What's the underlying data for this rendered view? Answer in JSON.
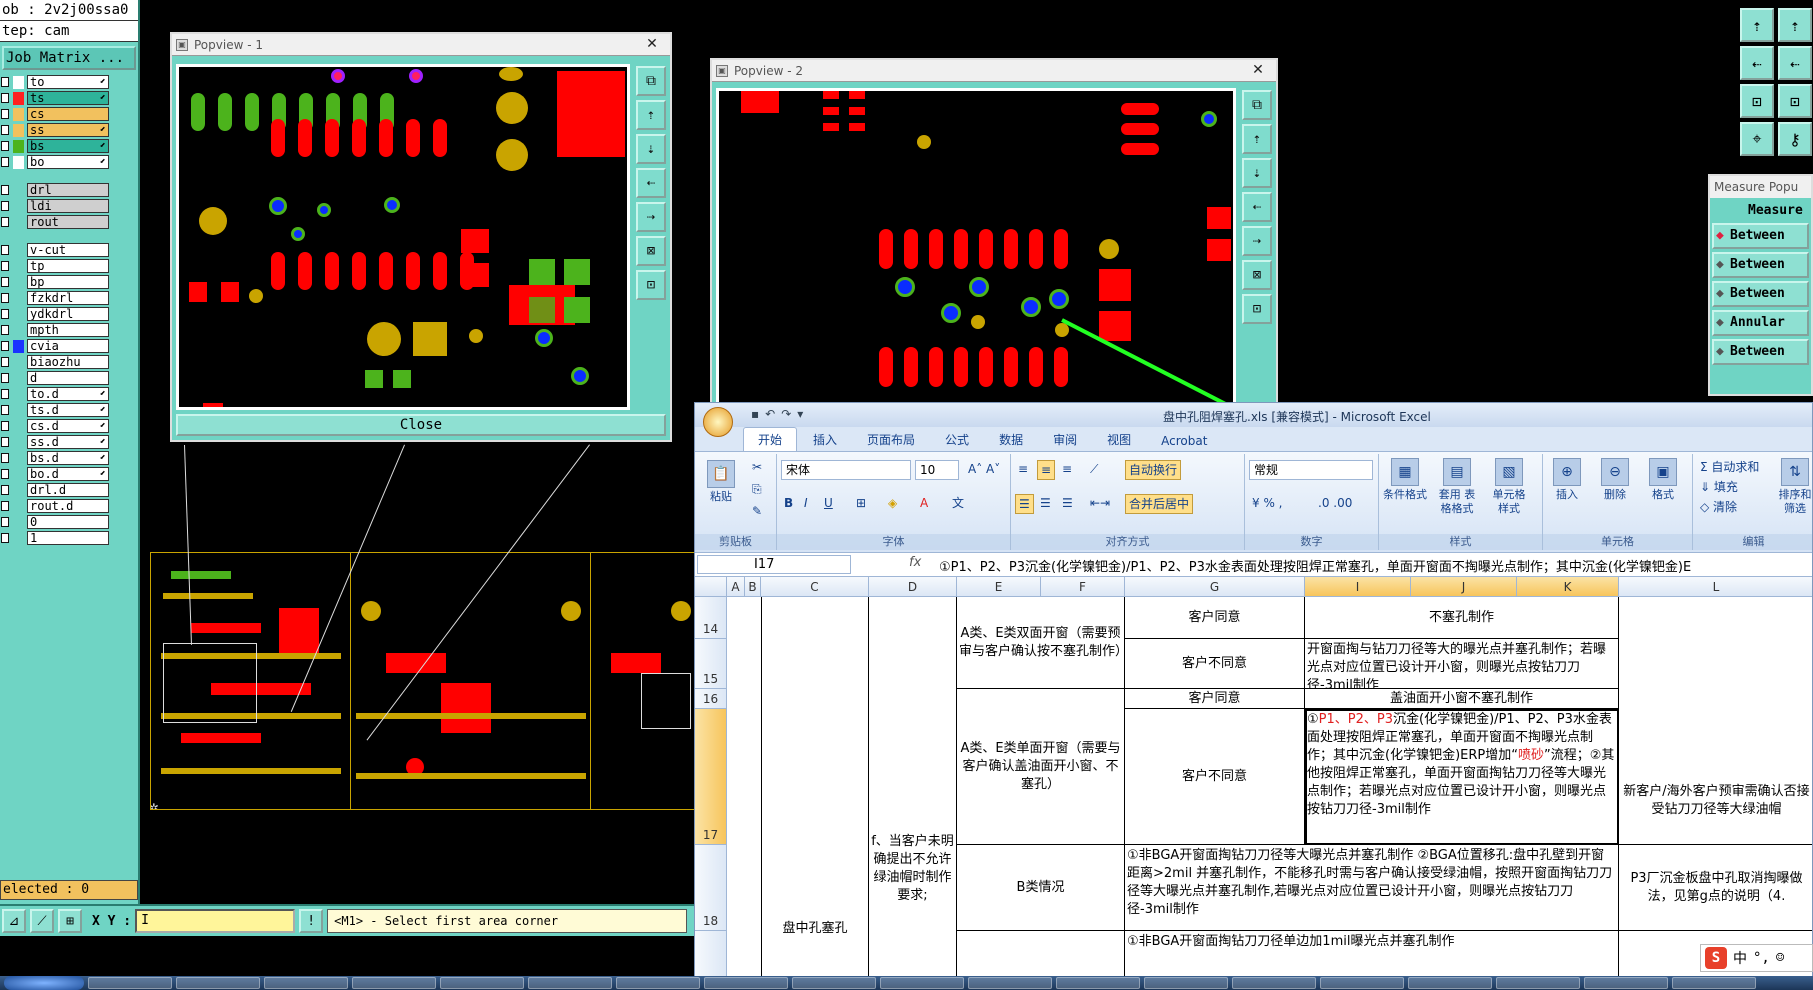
{
  "cam": {
    "job_line": "ob : 2v2j00ssa0",
    "step_line": "tep: cam",
    "job_matrix_label": "Job Matrix ...",
    "layers_group1": [
      {
        "name": "to",
        "color": "#ffffff"
      },
      {
        "name": "ts",
        "color": "#ff2020"
      },
      {
        "name": "cs",
        "color": "#f2c15e"
      },
      {
        "name": "ss",
        "color": "#f2c15e"
      },
      {
        "name": "bs",
        "color": "#4cb31c"
      },
      {
        "name": "bo",
        "color": "#ffffff"
      }
    ],
    "layers_group2": [
      "drl",
      "ldi",
      "rout"
    ],
    "layers_group3": [
      {
        "name": "v-cut",
        "color": "#6fd4c4"
      },
      {
        "name": "tp",
        "color": "#6fd4c4"
      },
      {
        "name": "bp",
        "color": "#6fd4c4"
      },
      {
        "name": "fzkdrl",
        "color": "#6fd4c4"
      },
      {
        "name": "ydkdrl",
        "color": "#6fd4c4"
      },
      {
        "name": "mpth",
        "color": "#6fd4c4"
      },
      {
        "name": "cvia",
        "color": "#1a33ff"
      },
      {
        "name": "biaozhu",
        "color": "#6fd4c4"
      },
      {
        "name": "d",
        "color": "#6fd4c4"
      },
      {
        "name": "to.d",
        "color": "#6fd4c4"
      },
      {
        "name": "ts.d",
        "color": "#6fd4c4"
      },
      {
        "name": "cs.d",
        "color": "#6fd4c4"
      },
      {
        "name": "ss.d",
        "color": "#6fd4c4"
      },
      {
        "name": "bs.d",
        "color": "#6fd4c4"
      },
      {
        "name": "bo.d",
        "color": "#6fd4c4"
      },
      {
        "name": "drl.d",
        "color": "#6fd4c4"
      },
      {
        "name": "rout.d",
        "color": "#6fd4c4"
      },
      {
        "name": "0",
        "color": "#6fd4c4"
      },
      {
        "name": "1",
        "color": "#6fd4c4"
      }
    ],
    "selected_text": "elected : 0",
    "xy_label": "X Y :",
    "xy_value": "I",
    "prompt": "<M1> - Select first area corner"
  },
  "popview1": {
    "title": "Popview - 1",
    "close_label": "Close"
  },
  "popview2": {
    "title": "Popview - 2"
  },
  "measure": {
    "title": "Measure Popu",
    "heading": "Measure",
    "items": [
      "Between ",
      "Between ",
      "Between ",
      "Annular ",
      "Between "
    ]
  },
  "excel": {
    "caption": "盘中孔阻焊塞孔.xls [兼容模式] - Microsoft Excel",
    "tabs": [
      "开始",
      "插入",
      "页面布局",
      "公式",
      "数据",
      "审阅",
      "视图",
      "Acrobat"
    ],
    "ribbon": {
      "paste": "粘贴",
      "clipboard": "剪贴板",
      "font_name": "宋体",
      "font_size": "10",
      "font_group": "字体",
      "wrap": "自动换行",
      "merge": "合并后居中",
      "align_group": "对齐方式",
      "number_format": "常规",
      "number_group": "数字",
      "cond_format": "条件格式",
      "table_format": "套用 表格格式",
      "cell_style": "单元格 样式",
      "style_group": "样式",
      "insert": "插入",
      "delete": "删除",
      "format": "格式",
      "cells_group": "单元格",
      "autosum": "自动求和",
      "fill": "填充",
      "clear": "清除",
      "sort": "排序和 筛选",
      "edit_group": "编辑"
    },
    "namebox": "I17",
    "fx": "fx",
    "formula": "①P1、P2、P3沉金(化学镍钯金)/P1、P2、P3水金表面处理按阻焊正常塞孔，单面开窗面不掏曝光点制作；其中沉金(化学镍钯金)E",
    "columns": [
      "A",
      "B",
      "C",
      "D",
      "E",
      "F",
      "G",
      "I",
      "J",
      "K",
      "L"
    ],
    "rows": [
      "14",
      "15",
      "16",
      "17",
      "18"
    ],
    "cells": {
      "c_main": "盘中孔塞孔",
      "d_main": "f、当客户未明确提出不允许绿油帽时制作要求;",
      "ef_a": "A类、E类双面开窗（需要预审与客户确认按不塞孔制作）",
      "ef_b": "A类、E类单面开窗（需要与客户确认盖油面开小窗、不塞孔）",
      "ef_c": "B类情况",
      "g14": "客户同意",
      "g15": "客户不同意",
      "g16": "客户同意",
      "g17": "客户不同意",
      "i14": "不塞孔制作",
      "i15": "开窗面掏与钻刀刀径等大的曝光点并塞孔制作；若曝光点对应位置已设计开小窗，则曝光点按钻刀刀径-3mil制作",
      "i16": "盖油面开小窗不塞孔制作",
      "i17_a": "①",
      "i17_red": "P1、P2、P3",
      "i17_b": "沉金(化学镍钯金)/P1、P2、P3水金表面处理按阻焊正常塞孔，单面开窗面不掏曝光点制作；其中沉金(化学镍钯金)ERP增加“",
      "i17_red2": "喷砂",
      "i17_c": "”流程；②其他按阻焊正常塞孔，单面开窗面掏钻刀刀径等大曝光点制作；若曝光点对应位置已设计开小窗，则曝光点按钻刀刀径-3mil制作",
      "g18": "①非BGA开窗面掏钻刀刀径等大曝光点并塞孔制作 ②BGA位置移孔:盘中孔壁到开窗距离>2mil 并塞孔制作，不能移孔时需与客户确认接受绿油帽，按照开窗面掏钻刀刀径等大曝光点并塞孔制作,若曝光点对应位置已设计开小窗，则曝光点按钻刀刀径-3mil制作",
      "g19": "①非BGA开窗面掏钻刀刀径单边加1mil曝光点并塞孔制作",
      "l17": "新客户/海外客户预审需确认否接受钻刀刀径等大绿油帽",
      "l18": "P3厂沉金板盘中孔取消掏曝做法，见第g点的说明（4."
    }
  },
  "ime": {
    "label": "中"
  }
}
